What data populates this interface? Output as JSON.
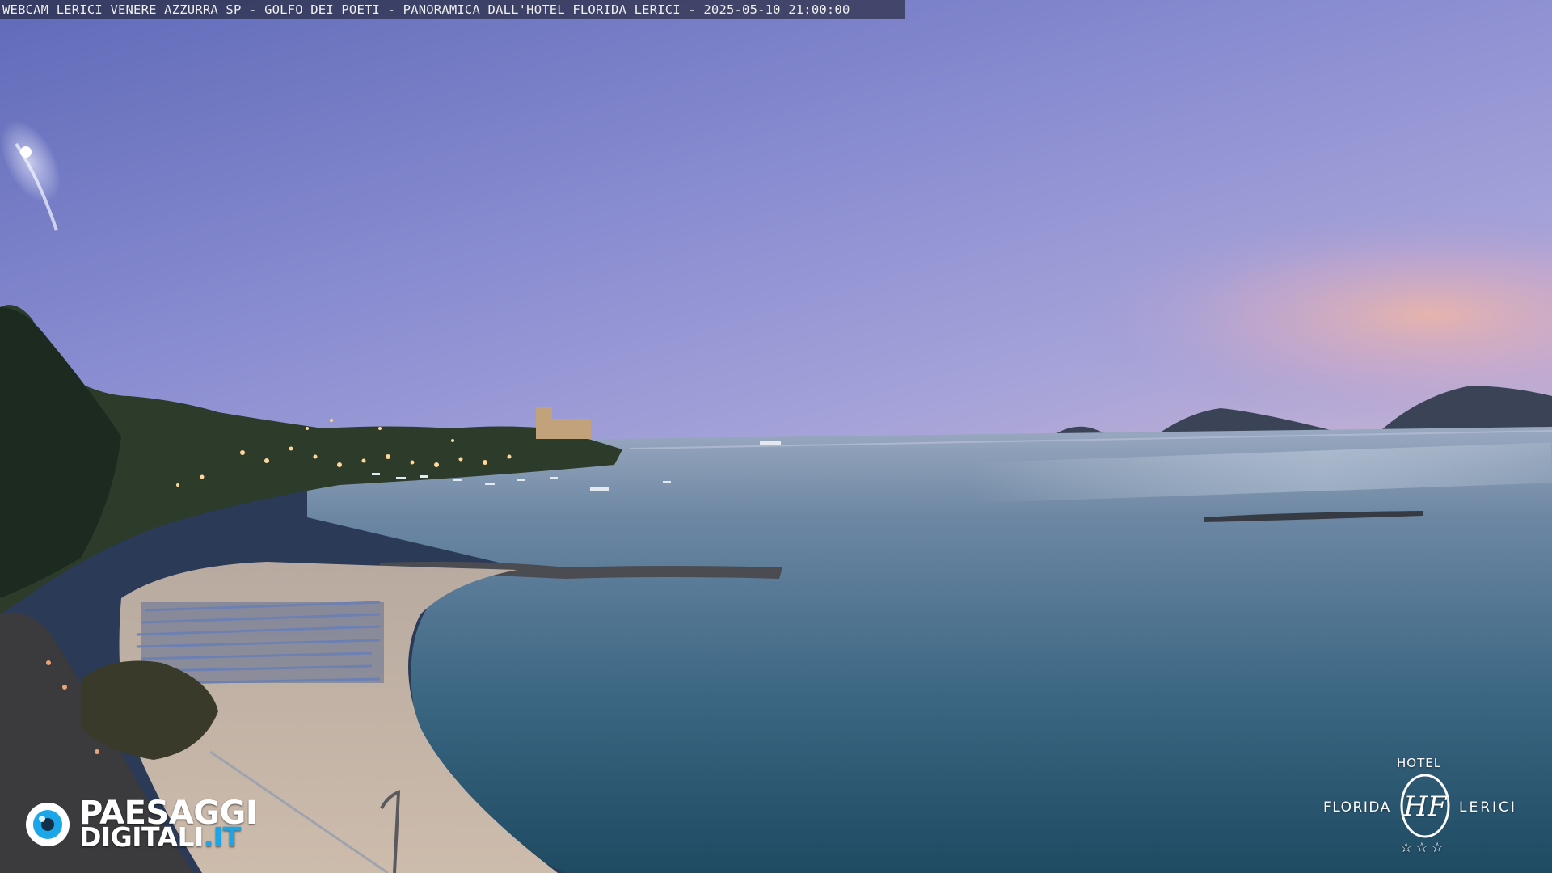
{
  "overlay": {
    "caption": "WEBCAM LERICI VENERE AZZURRA SP - GOLFO DEI POETI - PANORAMICA DALL'HOTEL FLORIDA LERICI - 2025-05-10 21:00:00"
  },
  "watermarks": {
    "paesaggi": {
      "line1": "PAESAGGI",
      "line2_main": "DIGITALI",
      "line2_suffix": ".IT",
      "accent_color": "#1aa6e8"
    },
    "hotel": {
      "top_word": "HOTEL",
      "left_word": "FLORIDA",
      "right_word": "LERICI",
      "monogram": "HF",
      "stars": "☆☆☆"
    }
  },
  "scene": {
    "time_of_day": "dusk",
    "colors": {
      "sky_top": "#6c74c6",
      "sky_mid": "#8e8fd2",
      "sky_horizon": "#c7a9c4",
      "sunset_glow": "#e3a7a4",
      "sea_far": "#8e9fb8",
      "sea_near": "#2a5a74",
      "sand": "#c8b7a6",
      "hill_green": "#2a3a26",
      "lights": "#ffd79a"
    }
  }
}
